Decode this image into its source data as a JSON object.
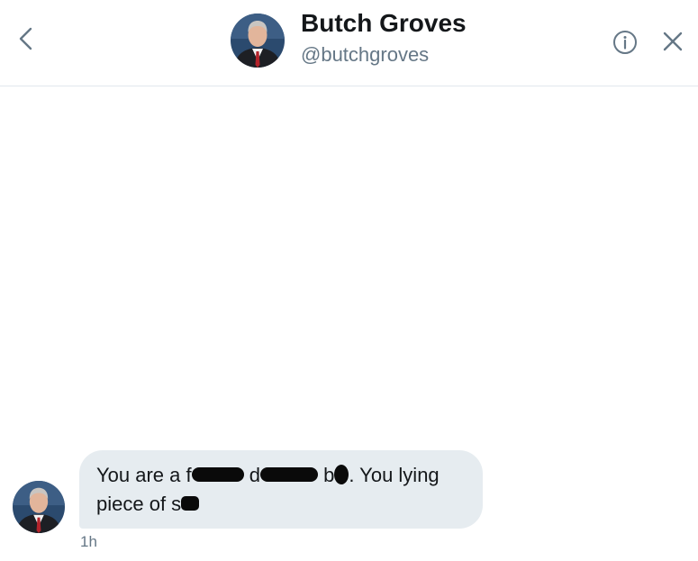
{
  "header": {
    "name": "Butch Groves",
    "handle": "@butchgroves",
    "back_icon": "chevron-left-icon",
    "info_icon": "info-circle-icon",
    "close_icon": "close-icon"
  },
  "message": {
    "line1_part1": "You are a f",
    "line1_part2": "d",
    "line1_part3": "b",
    "line1_part4": ". You lying",
    "line2_part1": "piece of s",
    "timestamp": "1h"
  },
  "colors": {
    "bubble": "#e6ecf0",
    "secondary_text": "#657786",
    "icon": "#657786",
    "divider": "#e1e8ed"
  }
}
